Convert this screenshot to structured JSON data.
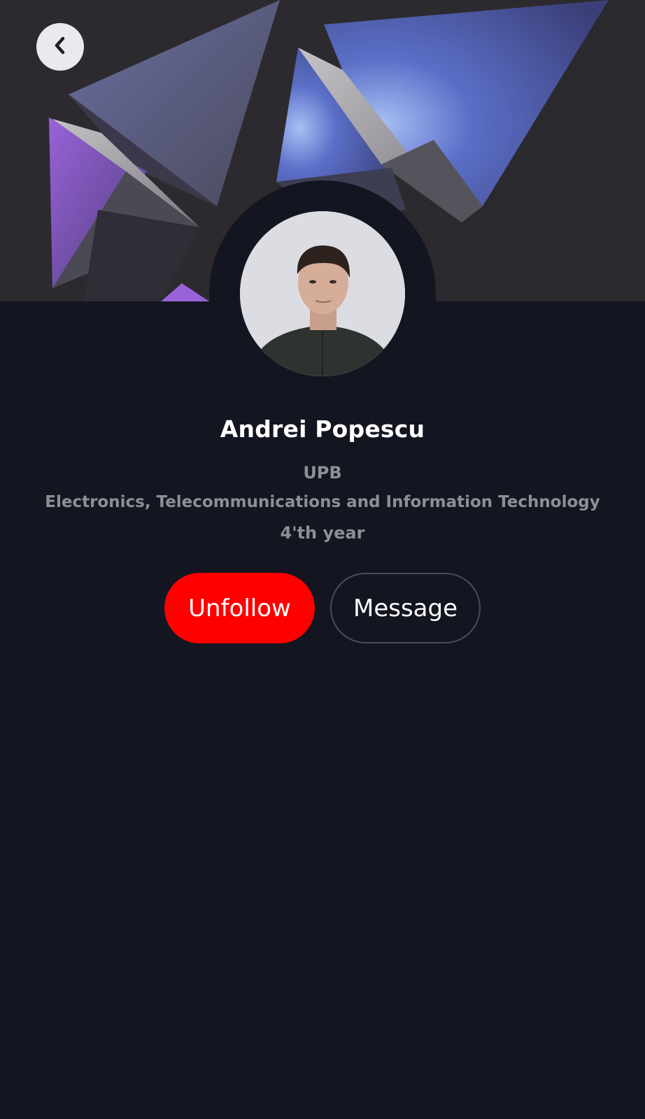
{
  "header": {
    "back_icon": "chevron-left-icon"
  },
  "profile": {
    "name": "Andrei Popescu",
    "university": "UPB",
    "faculty": "Electronics, Telecommunications and Information Technology",
    "year": "4'th year"
  },
  "actions": {
    "unfollow_label": "Unfollow",
    "message_label": "Message"
  },
  "colors": {
    "background": "#131520",
    "unfollow": "#ff0000",
    "name_text": "#ffffff",
    "info_text": "#8d8f98"
  }
}
